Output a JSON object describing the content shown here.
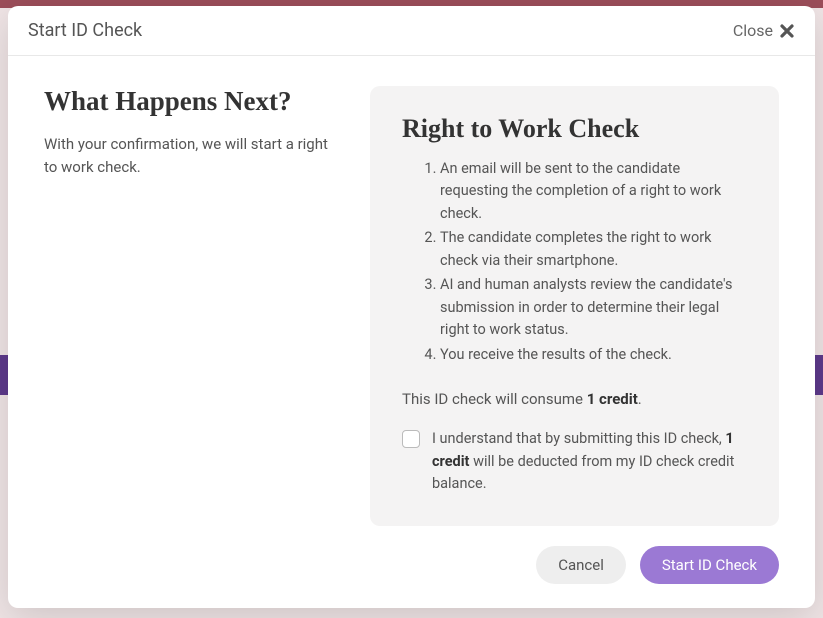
{
  "header": {
    "title": "Start ID Check",
    "close_label": "Close"
  },
  "left": {
    "heading": "What Happens Next?",
    "subtext": "With your confirmation, we will start a right to work check."
  },
  "right": {
    "heading": "Right to Work Check",
    "steps": [
      "An email will be sent to the candidate requesting the completion of a right to work check.",
      "The candidate completes the right to work check via their smartphone.",
      "AI and human analysts review the candidate's submission in order to determine their legal right to work status.",
      "You receive the results of the check."
    ],
    "credit_prefix": "This ID check will consume ",
    "credit_amount": "1 credit",
    "credit_suffix": ".",
    "consent_prefix": "I understand that by submitting this ID check, ",
    "consent_bold": "1 credit",
    "consent_suffix": " will be deducted from my ID check credit balance."
  },
  "footer": {
    "cancel_label": "Cancel",
    "submit_label": "Start ID Check"
  }
}
